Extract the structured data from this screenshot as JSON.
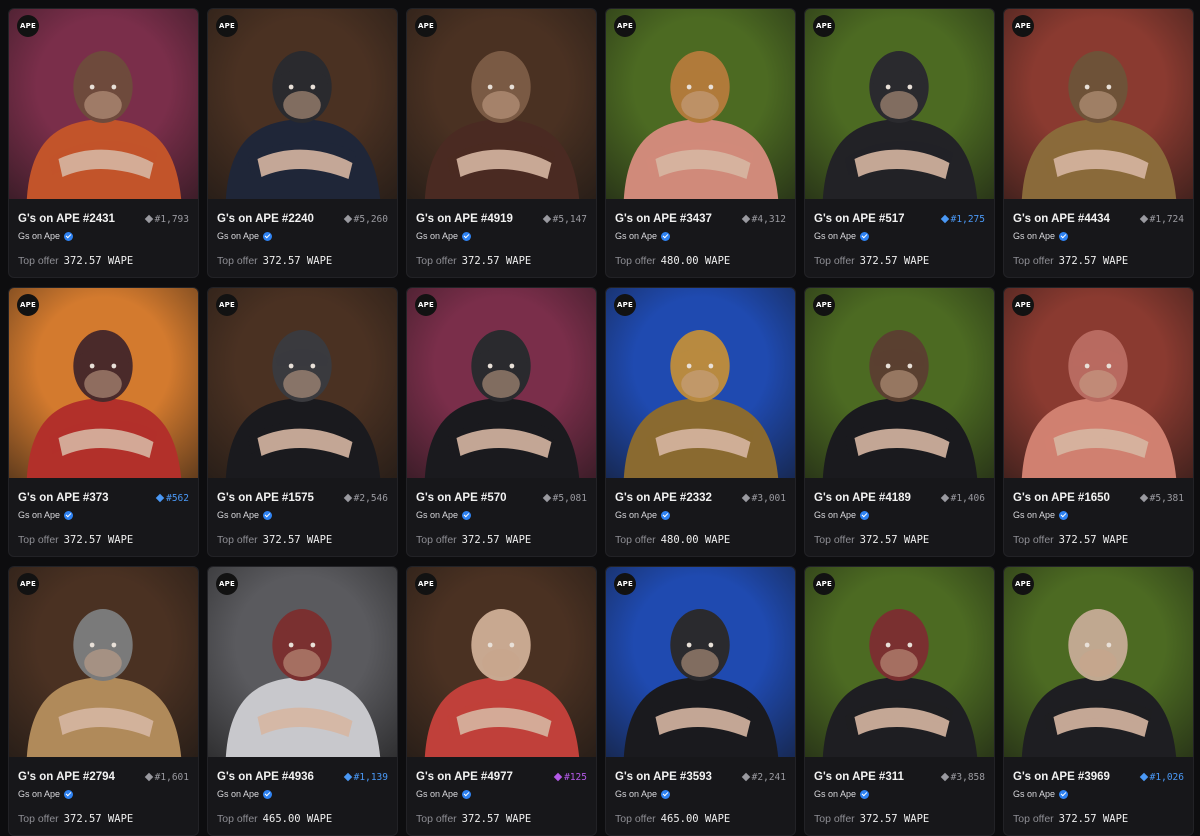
{
  "collection_name": "Gs on Ape",
  "badge_text": "APE",
  "offer_label": "Top offer",
  "cards": [
    {
      "name": "G's on APE #2431",
      "rank": "#1,793",
      "rank_color": "#9a9aa0",
      "offer": "372.57 WAPE",
      "bg": "#7a2e4a"
    },
    {
      "name": "G's on APE #2240",
      "rank": "#5,260",
      "rank_color": "#9a9aa0",
      "offer": "372.57 WAPE",
      "bg": "#4a3122"
    },
    {
      "name": "G's on APE #4919",
      "rank": "#5,147",
      "rank_color": "#9a9aa0",
      "offer": "372.57 WAPE",
      "bg": "#4a3122"
    },
    {
      "name": "G's on APE #3437",
      "rank": "#4,312",
      "rank_color": "#9a9aa0",
      "offer": "480.00 WAPE",
      "bg": "#4c6a22"
    },
    {
      "name": "G's on APE #517",
      "rank": "#1,275",
      "rank_color": "#4a98f5",
      "offer": "372.57 WAPE",
      "bg": "#4c6a22"
    },
    {
      "name": "G's on APE #4434",
      "rank": "#1,724",
      "rank_color": "#9a9aa0",
      "offer": "372.57 WAPE",
      "bg": "#8a3a30"
    },
    {
      "name": "G's on APE #373",
      "rank": "#562",
      "rank_color": "#4a98f5",
      "offer": "372.57 WAPE",
      "bg": "#d37a2e"
    },
    {
      "name": "G's on APE #1575",
      "rank": "#2,546",
      "rank_color": "#9a9aa0",
      "offer": "372.57 WAPE",
      "bg": "#4a3122"
    },
    {
      "name": "G's on APE #570",
      "rank": "#5,081",
      "rank_color": "#9a9aa0",
      "offer": "372.57 WAPE",
      "bg": "#7a2e4a"
    },
    {
      "name": "G's on APE #2332",
      "rank": "#3,001",
      "rank_color": "#9a9aa0",
      "offer": "480.00 WAPE",
      "bg": "#1f4ab0"
    },
    {
      "name": "G's on APE #4189",
      "rank": "#1,406",
      "rank_color": "#9a9aa0",
      "offer": "372.57 WAPE",
      "bg": "#4c6a22"
    },
    {
      "name": "G's on APE #1650",
      "rank": "#5,381",
      "rank_color": "#9a9aa0",
      "offer": "372.57 WAPE",
      "bg": "#8a3a30"
    },
    {
      "name": "G's on APE #2794",
      "rank": "#1,601",
      "rank_color": "#9a9aa0",
      "offer": "372.57 WAPE",
      "bg": "#4a3122"
    },
    {
      "name": "G's on APE #4936",
      "rank": "#1,139",
      "rank_color": "#4a98f5",
      "offer": "465.00 WAPE",
      "bg": "#5a5a5e"
    },
    {
      "name": "G's on APE #4977",
      "rank": "#125",
      "rank_color": "#b45ae8",
      "offer": "372.57 WAPE",
      "bg": "#4a3122"
    },
    {
      "name": "G's on APE #3593",
      "rank": "#2,241",
      "rank_color": "#9a9aa0",
      "offer": "465.00 WAPE",
      "bg": "#1f4ab0"
    },
    {
      "name": "G's on APE #311",
      "rank": "#3,858",
      "rank_color": "#9a9aa0",
      "offer": "372.57 WAPE",
      "bg": "#4c6a22"
    },
    {
      "name": "G's on APE #3969",
      "rank": "#1,026",
      "rank_color": "#4a98f5",
      "offer": "372.57 WAPE",
      "bg": "#4c6a22"
    }
  ],
  "figures": [
    {
      "fur": "#6e4a3c",
      "outfit": "#c2542a"
    },
    {
      "fur": "#2a2a2e",
      "outfit": "#1f2638"
    },
    {
      "fur": "#7a5a44",
      "outfit": "#4a2a22"
    },
    {
      "fur": "#b07a3a",
      "outfit": "#d08a7a"
    },
    {
      "fur": "#2a2a2e",
      "outfit": "#222226"
    },
    {
      "fur": "#6e5238",
      "outfit": "#8a6a3a"
    },
    {
      "fur": "#4a2a2a",
      "outfit": "#b2302a"
    },
    {
      "fur": "#3a3a3e",
      "outfit": "#1a1a1e"
    },
    {
      "fur": "#2a2a2e",
      "outfit": "#1a1a1e"
    },
    {
      "fur": "#b88a40",
      "outfit": "#8a6a30"
    },
    {
      "fur": "#5a4030",
      "outfit": "#1a1a1e"
    },
    {
      "fur": "#b86a60",
      "outfit": "#d08070"
    },
    {
      "fur": "#7a7a7a",
      "outfit": "#b08a5a"
    },
    {
      "fur": "#7a3030",
      "outfit": "#c8c8cc"
    },
    {
      "fur": "#c8a890",
      "outfit": "#c0403a"
    },
    {
      "fur": "#2a2a2e",
      "outfit": "#1a1a1e"
    },
    {
      "fur": "#7a3030",
      "outfit": "#1e1e22"
    },
    {
      "fur": "#c0a890",
      "outfit": "#1e1e22"
    }
  ]
}
